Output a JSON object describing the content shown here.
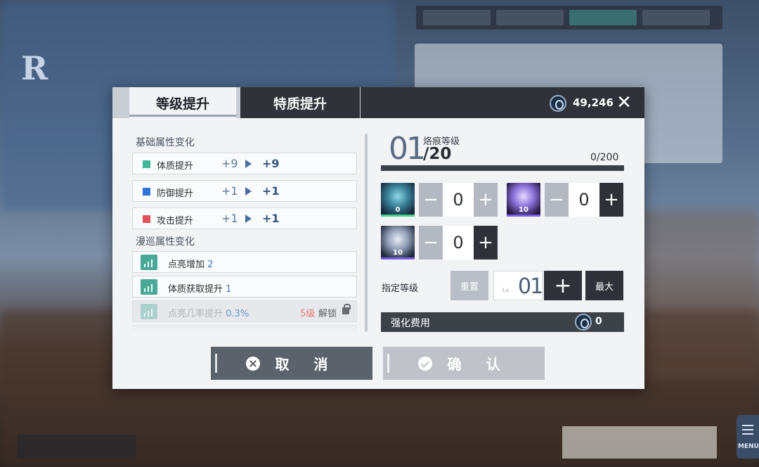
{
  "background": {
    "menu_label": "MENU"
  },
  "tabs": {
    "level_up": "等级提升",
    "trait_up": "特质提升"
  },
  "header": {
    "balance": "49,246"
  },
  "left": {
    "basic_title": "基础属性变化",
    "attrs": [
      {
        "name": "体质提升",
        "from": "+9",
        "to": "+9",
        "color": "#3fb89a"
      },
      {
        "name": "防御提升",
        "from": "+1",
        "to": "+1",
        "color": "#2e74d6"
      },
      {
        "name": "攻击提升",
        "from": "+1",
        "to": "+1",
        "color": "#e2525c"
      }
    ],
    "roam_title": "漫巡属性变化",
    "roam": [
      {
        "name": "点亮增加",
        "value": "2"
      },
      {
        "name": "体质获取提升",
        "value": "1"
      },
      {
        "name": "点亮几率提升",
        "value": "0.3%",
        "lock_level": "5级",
        "unlock": "解锁"
      }
    ]
  },
  "right": {
    "level": "01",
    "level_label": "烙痕等级",
    "level_max": "/20",
    "exp": "0/200",
    "exp_progress": 0,
    "materials": [
      {
        "count": "0",
        "amount": "0",
        "band": "#3fd08a"
      },
      {
        "count": "10",
        "amount": "0",
        "band": "#7b5cf0"
      },
      {
        "count": "10",
        "amount": "0",
        "band": "#7b5cf0"
      }
    ],
    "assign_label": "指定等级",
    "reset": "重置",
    "input_prefix": "Lv.",
    "input_value": "01",
    "max": "最大",
    "cost_label": "强化费用",
    "cost_value": "0"
  },
  "actions": {
    "cancel": "取 消",
    "confirm": "确 认"
  }
}
